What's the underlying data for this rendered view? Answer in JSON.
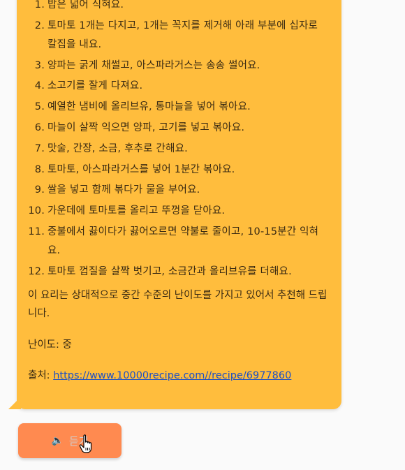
{
  "recipe": {
    "steps": [
      {
        "num": "1",
        "text": "밥은 넓어 식혀요."
      },
      {
        "num": "2",
        "text": "토마토 1개는 다지고, 1개는 꼭지를 제거해 아래 부분에 십자로 칼집을 내요."
      },
      {
        "num": "3",
        "text": "양파는 굵게 채썰고, 아스파라거스는 송송 썰어요."
      },
      {
        "num": "4",
        "text": "소고기를 잘게 다져요."
      },
      {
        "num": "5",
        "text": "예열한 냄비에 올리브유, 통마늘을 넣어 볶아요."
      },
      {
        "num": "6",
        "text": "마늘이 살짝 익으면 양파, 고기를 넣고 볶아요."
      },
      {
        "num": "7",
        "text": "맛술, 간장, 소금, 후추로 간해요."
      },
      {
        "num": "8",
        "text": "토마토, 아스파라거스를 넣어 1분간 볶아요."
      },
      {
        "num": "9",
        "text": "쌀을 넣고 함께 볶다가 물을 부어요."
      },
      {
        "num": "10",
        "text": "가운데에 토마토를 올리고 뚜껑을 닫아요."
      },
      {
        "num": "11",
        "text": "중불에서 끓이다가 끓어오르면 약불로 줄이고, 10-15분간 익혀요."
      },
      {
        "num": "12",
        "text": "토마토 껍질을 살짝 벗기고, 소금간과 올리브유를 더해요."
      }
    ],
    "summary": "이 요리는 상대적으로 중간 수준의 난이도를 가지고 있어서 추천해 드립니다.",
    "difficulty": "난이도: 중",
    "source_label": "출처: ",
    "source_url": "https://www.10000recipe.com//recipe/6977860"
  },
  "listen_button": {
    "label": "듣기",
    "icon": "speaker-icon"
  },
  "colors": {
    "bubble": "#ffbd3d",
    "button": "#ff8a50",
    "link": "#1d4fc4"
  }
}
